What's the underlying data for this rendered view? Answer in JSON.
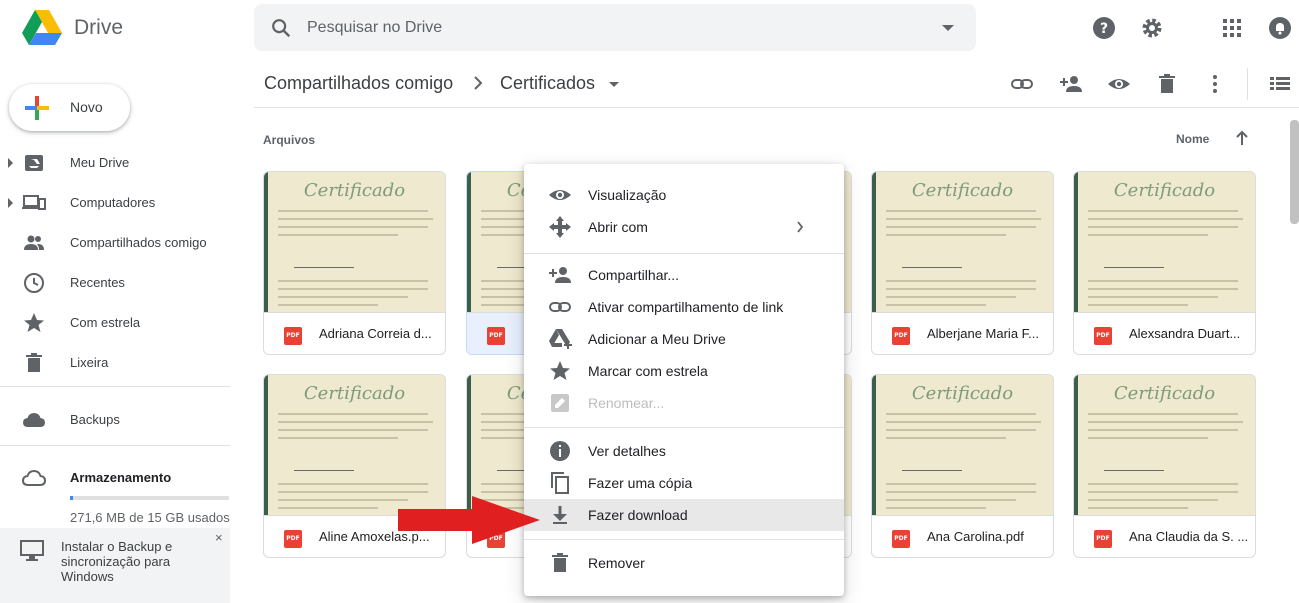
{
  "app": {
    "name": "Drive"
  },
  "search": {
    "placeholder": "Pesquisar no Drive"
  },
  "header_icons": [
    "help-icon",
    "settings-icon",
    "apps-icon",
    "notifications-icon"
  ],
  "new_button": {
    "label": "Novo"
  },
  "sidebar": {
    "items": [
      {
        "label": "Meu Drive",
        "icon": "my-drive-icon"
      },
      {
        "label": "Computadores",
        "icon": "computers-icon"
      },
      {
        "label": "Compartilhados comigo",
        "icon": "shared-icon"
      },
      {
        "label": "Recentes",
        "icon": "clock-icon"
      },
      {
        "label": "Com estrela",
        "icon": "star-icon"
      },
      {
        "label": "Lixeira",
        "icon": "trash-icon"
      }
    ],
    "backups": "Backups",
    "storage": {
      "label": "Armazenamento",
      "usage_text": "271,6 MB de 15 GB usados",
      "used_fraction": 0.018
    },
    "install_banner": "Instalar o Backup e sincronização para Windows",
    "install_banner_close": "×"
  },
  "breadcrumb": {
    "parent": "Compartilhados comigo",
    "current": "Certificados"
  },
  "toolbar_icons": [
    "link-icon",
    "add-person-icon",
    "preview-icon",
    "trash-icon",
    "more-icon",
    "list-view-icon"
  ],
  "files": {
    "section_label": "Arquivos",
    "sort_label": "Nome",
    "row1": [
      "Adriana Correia d...",
      "",
      "",
      "Alberjane Maria F...",
      "Alexsandra Duart..."
    ],
    "row2": [
      "Aline Amoxelas.p...",
      "",
      "",
      "Ana Carolina.pdf",
      "Ana Claudia da S. ..."
    ],
    "file_type_badge": "PDF",
    "thumb_title": "Certificado"
  },
  "context_menu": {
    "items": [
      {
        "label": "Visualização",
        "icon": "eye-icon"
      },
      {
        "label": "Abrir com",
        "icon": "open-with-icon"
      },
      {
        "label": "Compartilhar...",
        "icon": "share-icon"
      },
      {
        "label": "Ativar compartilhamento de link",
        "icon": "link-icon"
      },
      {
        "label": "Adicionar a Meu Drive",
        "icon": "add-to-drive-icon"
      },
      {
        "label": "Marcar com estrela",
        "icon": "star-icon"
      },
      {
        "label": "Renomear...",
        "icon": "rename-icon",
        "disabled": true
      },
      {
        "label": "Ver detalhes",
        "icon": "info-icon"
      },
      {
        "label": "Fazer uma cópia",
        "icon": "copy-icon"
      },
      {
        "label": "Fazer download",
        "icon": "download-icon",
        "highlighted": true
      },
      {
        "label": "Remover",
        "icon": "trash-icon"
      }
    ]
  },
  "colors": {
    "accent": "#4285f4",
    "pdf_red": "#e94235",
    "arrow_red": "#e02020"
  }
}
